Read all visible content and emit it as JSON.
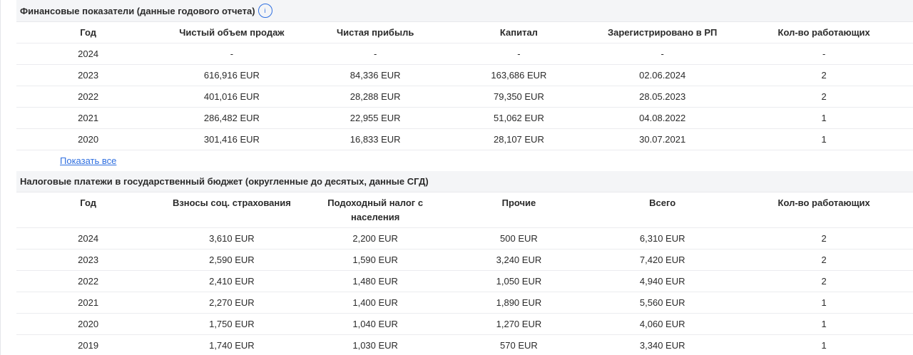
{
  "financial": {
    "title": "Финансовые показатели (данные годового отчета)",
    "info_icon": "i",
    "headers": [
      "Год",
      "Чистый объем продаж",
      "Чистая прибыль",
      "Капитал",
      "Зарегистрировано в РП",
      "Кол-во работающих"
    ],
    "rows": [
      [
        "2024",
        "-",
        "-",
        "-",
        "-",
        "-"
      ],
      [
        "2023",
        "616,916 EUR",
        "84,336 EUR",
        "163,686 EUR",
        "02.06.2024",
        "2"
      ],
      [
        "2022",
        "401,016 EUR",
        "28,288 EUR",
        "79,350 EUR",
        "28.05.2023",
        "2"
      ],
      [
        "2021",
        "286,482 EUR",
        "22,955 EUR",
        "51,062 EUR",
        "04.08.2022",
        "1"
      ],
      [
        "2020",
        "301,416 EUR",
        "16,833 EUR",
        "28,107 EUR",
        "30.07.2021",
        "1"
      ]
    ],
    "show_all": "Показать все"
  },
  "taxes": {
    "title": "Налоговые платежи в государственный бюджет (округленные до десятых, данные СГД)",
    "headers": [
      "Год",
      "Взносы соц. страхования",
      "Подоходный налог с населения",
      "Прочие",
      "Всего",
      "Кол-во работающих"
    ],
    "rows": [
      [
        "2024",
        "3,610 EUR",
        "2,200 EUR",
        "500 EUR",
        "6,310 EUR",
        "2"
      ],
      [
        "2023",
        "2,590 EUR",
        "1,590 EUR",
        "3,240 EUR",
        "7,420 EUR",
        "2"
      ],
      [
        "2022",
        "2,410 EUR",
        "1,480 EUR",
        "1,050 EUR",
        "4,940 EUR",
        "2"
      ],
      [
        "2021",
        "2,270 EUR",
        "1,400 EUR",
        "1,890 EUR",
        "5,560 EUR",
        "1"
      ],
      [
        "2020",
        "1,750 EUR",
        "1,040 EUR",
        "1,270 EUR",
        "4,060 EUR",
        "1"
      ],
      [
        "2019",
        "1,740 EUR",
        "1,030 EUR",
        "570 EUR",
        "3,340 EUR",
        "1"
      ]
    ]
  }
}
